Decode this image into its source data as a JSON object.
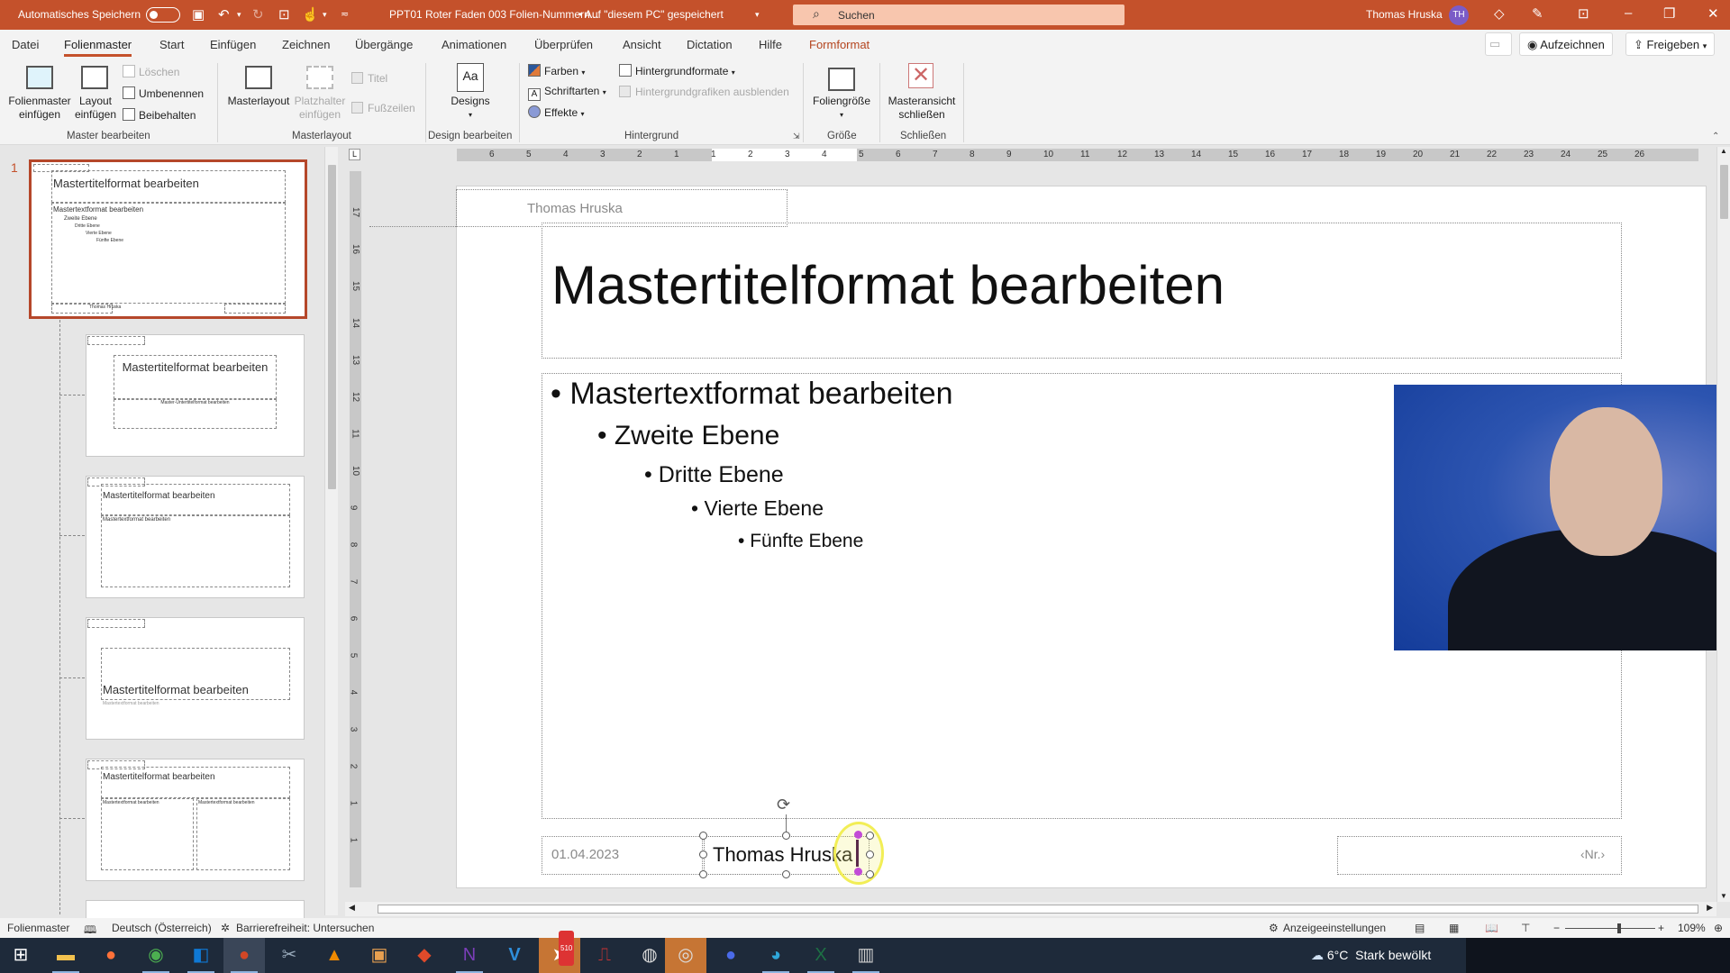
{
  "titlebar": {
    "autosave_label": "Automatisches Speichern",
    "autosave_on": false,
    "doc_title": "PPT01 Roter Faden 003 Folien-Nummern...",
    "save_status": "• Auf \"diesem PC\" gespeichert",
    "search_placeholder": "Suchen",
    "user_name": "Thomas Hruska",
    "user_initials": "TH",
    "icons": [
      "save-icon",
      "undo-icon",
      "redo-icon",
      "presentation-icon",
      "touch-mode-icon",
      "customize-icon"
    ]
  },
  "tabs": [
    {
      "label": "Datei"
    },
    {
      "label": "Folienmaster",
      "active": true
    },
    {
      "label": "Start"
    },
    {
      "label": "Einfügen"
    },
    {
      "label": "Zeichnen"
    },
    {
      "label": "Übergänge"
    },
    {
      "label": "Animationen"
    },
    {
      "label": "Überprüfen"
    },
    {
      "label": "Ansicht"
    },
    {
      "label": "Dictation"
    },
    {
      "label": "Hilfe"
    },
    {
      "label": "Formformat",
      "contextual": true
    }
  ],
  "ribbon_right": {
    "record": "Aufzeichnen",
    "share": "Freigeben"
  },
  "ribbon": {
    "master_bearbeiten": {
      "group": "Master bearbeiten",
      "insert_master": [
        "Folienmaster",
        "einfügen"
      ],
      "insert_layout": [
        "Layout",
        "einfügen"
      ],
      "delete": "Löschen",
      "rename": "Umbenennen",
      "preserve": "Beibehalten"
    },
    "masterlayout": {
      "group": "Masterlayout",
      "masterlayout": "Masterlayout",
      "placeholder": [
        "Platzhalter",
        "einfügen"
      ],
      "title_cb": "Titel",
      "footer_cb": "Fußzeilen"
    },
    "design": {
      "group": "Design bearbeiten",
      "designs": "Designs"
    },
    "background": {
      "group": "Hintergrund",
      "colors": "Farben",
      "fonts": "Schriftarten",
      "effects": "Effekte",
      "bg_styles": "Hintergrundformate",
      "hide_bg": "Hintergrundgrafiken ausblenden"
    },
    "size": {
      "group": "Größe",
      "slide_size": "Foliengröße"
    },
    "close": {
      "group": "Schließen",
      "close_master": [
        "Masteransicht",
        "schließen"
      ]
    }
  },
  "thumbnails": {
    "slide_number": "1",
    "master": {
      "header": "Thomas Hruska",
      "title": "Mastertitelformat bearbeiten",
      "levels": [
        "Mastertextformat bearbeiten",
        "Zweite Ebene",
        "Dritte Ebene",
        "Vierte Ebene",
        "Fünfte Ebene"
      ],
      "footer": "Thomas Hruska"
    },
    "layouts": [
      {
        "title": "Mastertitelformat bearbeiten",
        "subtitle": "Master-Untertitelformat bearbeiten"
      },
      {
        "title": "Mastertitelformat bearbeiten",
        "body": "Mastertextformat bearbeiten"
      },
      {
        "title": "Mastertitelformat bearbeiten",
        "body": "Mastertextformat bearbeiten"
      },
      {
        "title": "Mastertitelformat bearbeiten",
        "body": "Mastertextformat bearbeiten"
      }
    ]
  },
  "ruler": {
    "h_ticks": [
      "6",
      "5",
      "4",
      "3",
      "2",
      "1",
      "1",
      "2",
      "3",
      "4",
      "5",
      "6",
      "7",
      "8",
      "9",
      "10",
      "11",
      "12",
      "13",
      "14",
      "15",
      "16",
      "17",
      "18",
      "19",
      "20",
      "21",
      "22",
      "23",
      "24",
      "25",
      "26"
    ],
    "v_ticks": [
      "17",
      "16",
      "15",
      "14",
      "13",
      "12",
      "11",
      "10",
      "9",
      "8",
      "7",
      "6",
      "5",
      "4",
      "3",
      "2",
      "1",
      "1"
    ]
  },
  "slide": {
    "header": "Thomas Hruska",
    "title": "Mastertitelformat bearbeiten",
    "levels": [
      "Mastertextformat bearbeiten",
      "Zweite Ebene",
      "Dritte Ebene",
      "Vierte Ebene",
      "Fünfte Ebene"
    ],
    "date": "01.04.2023",
    "footer": "Thomas Hruska",
    "page_number": "‹Nr.›"
  },
  "statusbar": {
    "view": "Folienmaster",
    "language": "Deutsch (Österreich)",
    "accessibility": "Barrierefreiheit: Untersuchen",
    "display_settings": "Anzeigeeinstellungen",
    "zoom": "109%",
    "zoom_fraction": 0.6
  },
  "taskbar": {
    "apps": [
      "start",
      "file-explorer",
      "firefox",
      "chrome",
      "outlook",
      "powerpoint",
      "snipping-tool",
      "vlc",
      "paint-app",
      "lips-app",
      "onenote",
      "visio",
      "telegram",
      "acrobat",
      "obs",
      "recorder",
      "blue-yeti",
      "edge",
      "excel",
      "remote-app"
    ],
    "telegram_badge": "510",
    "weather_temp": "6°C",
    "weather_desc": "Stark bewölkt"
  }
}
